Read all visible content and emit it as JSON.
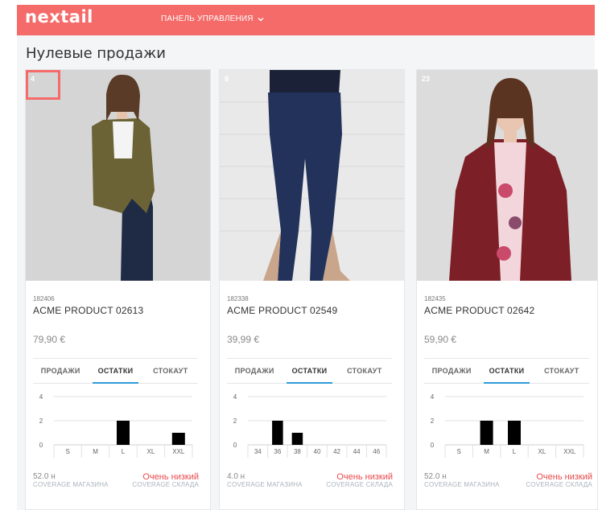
{
  "header": {
    "logo": "nextail",
    "nav_label": "ПАНЕЛЬ УПРАВЛЕНИЯ"
  },
  "page": {
    "title": "Нулевые продажи"
  },
  "tabs": [
    "ПРОДАЖИ",
    "ОСТАТКИ",
    "СТОКАУТ"
  ],
  "labels": {
    "coverage_store": "COVERAGE МАГАЗИНА",
    "coverage_warehouse": "COVERAGE СКЛАДА"
  },
  "products": [
    {
      "badge": "4",
      "sku": "182406",
      "name": "ACME PRODUCT 02613",
      "price": "79,90 €",
      "coverage": "52.0 н",
      "status": "Очень низкий",
      "chart_data": {
        "type": "bar",
        "categories": [
          "S",
          "M",
          "L",
          "XL",
          "XXL"
        ],
        "values": [
          0,
          0,
          2,
          0,
          1
        ],
        "ylim": [
          0,
          4
        ],
        "yticks": [
          "0",
          "2",
          "4"
        ]
      }
    },
    {
      "badge": "8",
      "sku": "182338",
      "name": "ACME PRODUCT 02549",
      "price": "39,99 €",
      "coverage": "4.0 н",
      "status": "Очень низкий",
      "chart_data": {
        "type": "bar",
        "categories": [
          "34",
          "36",
          "38",
          "40",
          "42",
          "44",
          "46"
        ],
        "values": [
          0,
          2,
          1,
          0,
          0,
          0,
          0
        ],
        "ylim": [
          0,
          4
        ],
        "yticks": [
          "0",
          "2",
          "4"
        ]
      }
    },
    {
      "badge": "23",
      "sku": "182435",
      "name": "ACME PRODUCT 02642",
      "price": "59,90 €",
      "coverage": "52.0 н",
      "status": "Очень низкий",
      "chart_data": {
        "type": "bar",
        "categories": [
          "S",
          "M",
          "L",
          "XL",
          "XXL"
        ],
        "values": [
          0,
          2,
          2,
          0,
          0
        ],
        "ylim": [
          0,
          4
        ],
        "yticks": [
          "0",
          "2",
          "4"
        ]
      }
    }
  ]
}
